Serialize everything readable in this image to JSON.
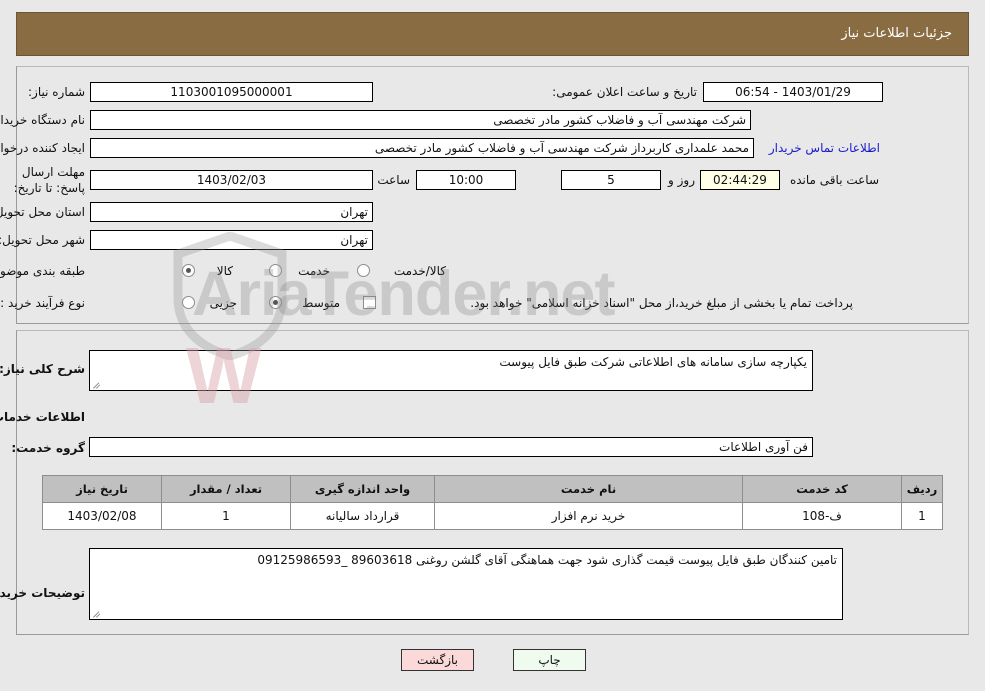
{
  "header": {
    "title": "جزئیات اطلاعات نیاز",
    "bg_color": "#8a6c42",
    "text_color": "#ffffff"
  },
  "watermark": {
    "text": "AriaTender.net",
    "mark": "W"
  },
  "summary": {
    "need_number_label": "شماره نیاز:",
    "need_number_value": "1103001095000001",
    "announce_label": "تاریخ و ساعت اعلان عمومی:",
    "announce_value": "1403/01/29 - 06:54",
    "buyer_org_label": "نام دستگاه خریدار:",
    "buyer_org_value": "شرکت مهندسی  آب و فاضلاب کشور  مادر تخصصی",
    "creator_label": "ایجاد کننده درخواست:",
    "creator_value": "محمد علمداری کاربرداز شرکت مهندسی  آب و فاضلاب کشور  مادر تخصصی",
    "contact_link": "اطلاعات تماس خریدار",
    "deadline_label": "مهلت ارسال پاسخ: تا تاریخ:",
    "deadline_date": "1403/02/03",
    "deadline_time_label": "ساعت",
    "deadline_time": "10:00",
    "remaining_days": "5",
    "remaining_days_label": "روز و",
    "remaining_clock": "02:44:29",
    "remaining_clock_label": "ساعت باقی مانده",
    "province_label": "استان محل تحویل:",
    "province_value": "تهران",
    "city_label": "شهر محل تحویل:",
    "city_value": "تهران",
    "category_label": "طبقه بندی موضوعی:",
    "category_options": [
      {
        "label": "کالا",
        "selected": false
      },
      {
        "label": "خدمت",
        "selected": true
      },
      {
        "label": "کالا/خدمت",
        "selected": false
      }
    ],
    "process_label": "نوع فرآیند خرید :",
    "process_options": [
      {
        "label": "جزیی",
        "selected": false
      },
      {
        "label": "متوسط",
        "selected": true
      }
    ],
    "treasury_checkbox_label": "پرداخت تمام یا بخشی از مبلغ خرید،از محل \"اسناد خزانه اسلامی\" خواهد بود.",
    "treasury_checked": false
  },
  "details": {
    "general_desc_label": "شرح کلی نیاز:",
    "general_desc_value": "یکپارچه سازی سامانه های اطلاعاتی شرکت طبق فایل پیوست",
    "services_section_title": "اطلاعات خدمات مورد نیاز",
    "service_group_label": "گروه خدمت:",
    "service_group_value": "فن آوری اطلاعات",
    "buyer_notes_label": "توضیحات خریدار:",
    "buyer_notes_value": "تامین کنندگان طبق فایل پیوست قیمت گذاری شود جهت هماهنگی آقای گلشن روغنی 89603618 _09125986593"
  },
  "table": {
    "headers": [
      "ردیف",
      "کد خدمت",
      "نام خدمت",
      "واحد اندازه گیری",
      "تعداد / مقدار",
      "تاریخ نیاز"
    ],
    "rows": [
      {
        "row_no": "1",
        "service_code": "ف-108",
        "service_name": "خرید نرم افزار",
        "unit": "قرارداد سالیانه",
        "quantity": "1",
        "need_date": "1403/02/08"
      }
    ]
  },
  "footer": {
    "print_label": "چاپ",
    "back_label": "بازگشت"
  }
}
